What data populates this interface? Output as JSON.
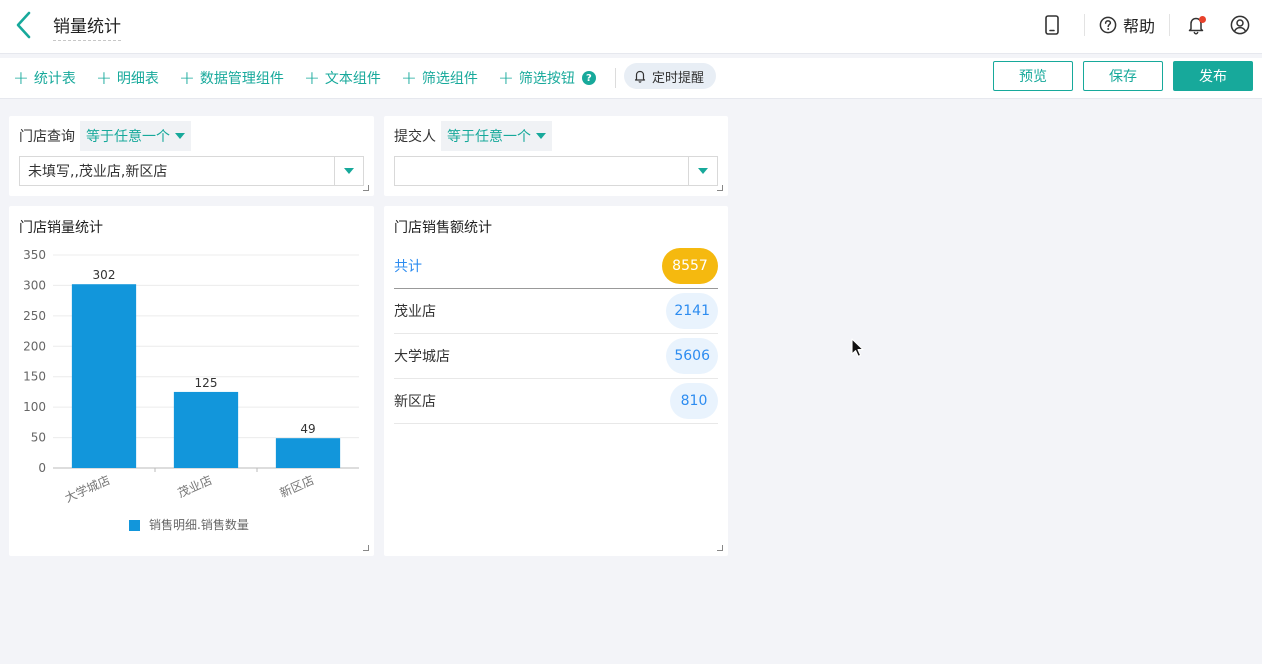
{
  "header": {
    "title": "销量统计",
    "help_label": "帮助"
  },
  "toolbar": {
    "items": [
      {
        "label": "统计表"
      },
      {
        "label": "明细表"
      },
      {
        "label": "数据管理组件"
      },
      {
        "label": "文本组件"
      },
      {
        "label": "筛选组件"
      },
      {
        "label": "筛选按钮"
      }
    ],
    "reminder_label": "定时提醒",
    "preview_label": "预览",
    "save_label": "保存",
    "publish_label": "发布"
  },
  "filters": [
    {
      "label": "门店查询",
      "operator": "等于任意一个",
      "value": "未填写,,茂业店,新区店"
    },
    {
      "label": "提交人",
      "operator": "等于任意一个",
      "value": ""
    }
  ],
  "bar_card": {
    "title": "门店销量统计"
  },
  "chart_data": {
    "type": "bar",
    "categories": [
      "大学城店",
      "茂业店",
      "新区店"
    ],
    "series": [
      {
        "name": "销售明细.销售数量",
        "values": [
          302,
          125,
          49
        ]
      }
    ],
    "ylim": [
      0,
      350
    ],
    "yticks": [
      0,
      50,
      100,
      150,
      200,
      250,
      300,
      350
    ],
    "grid": true,
    "legend_position": "bottom",
    "data_labels": true,
    "color": "#1296db"
  },
  "sum_card": {
    "title": "门店销售额统计",
    "rows": [
      {
        "name": "共计",
        "value": "8557"
      },
      {
        "name": "茂业店",
        "value": "2141"
      },
      {
        "name": "大学城店",
        "value": "5606"
      },
      {
        "name": "新区店",
        "value": "810"
      }
    ]
  },
  "colors": {
    "accent": "#17a99b",
    "bar": "#1296db",
    "total_badge": "#f5b90f",
    "value_text": "#2d8cf0"
  }
}
